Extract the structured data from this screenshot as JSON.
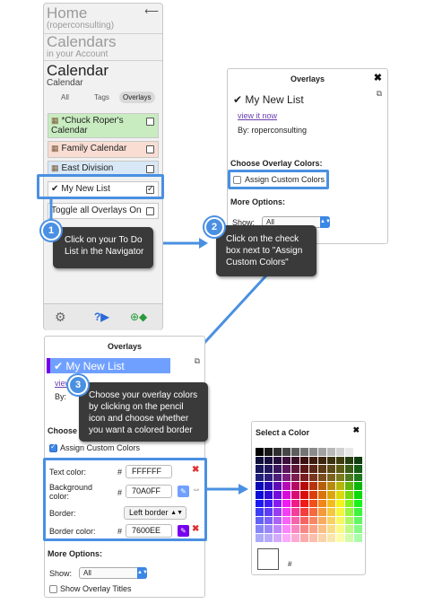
{
  "nav": {
    "home": {
      "title": "Home",
      "sub": "(roperconsulting)",
      "back_icon": "back-arrow-icon"
    },
    "calendars": {
      "title": "Calendars",
      "sub": "in your Account"
    },
    "calendar": {
      "title": "Calendar",
      "sub": "Calendar"
    },
    "tabs": [
      "All",
      "Tags",
      "Overlays"
    ],
    "items": [
      {
        "label": "*Chuck Roper's Calendar",
        "color": "#c8ecc0",
        "checked": false
      },
      {
        "label": "Family Calendar",
        "color": "#f9ddd3",
        "checked": false
      },
      {
        "label": "East Division",
        "color": "#d8e8f6",
        "checked": false
      },
      {
        "label": "My New List",
        "color": "#ffffff",
        "checked": true
      },
      {
        "label": "Toggle all Overlays On",
        "color": "#ffffff",
        "checked": false
      }
    ],
    "bottom_icons": [
      "gear-icon",
      "help-icon",
      "add-tag-icon"
    ]
  },
  "callouts": {
    "c1": {
      "num": "1",
      "text": "Click on your To Do List in the Navigator"
    },
    "c2": {
      "num": "2",
      "text": "Click on the check box next to \"Assign Custom Colors\""
    },
    "c3": {
      "num": "3",
      "text": "Choose your overlay colors by clicking on the pencil icon and choose whether you want a colored border"
    }
  },
  "panel1": {
    "title": "Overlays",
    "close": "✖",
    "list_name": "My New List",
    "view_link": "view it now",
    "by": "By: roperconsulting",
    "choose": "Choose Overlay Colors:",
    "assign": "Assign Custom Colors",
    "more": "More Options:",
    "show_label": "Show:",
    "show_value": "All"
  },
  "panel2": {
    "title": "Overlays",
    "list_name": "My New List",
    "view_frag": "view",
    "by_frag": "By:",
    "choose_frag": "Choose",
    "assign": "Assign Custom Colors",
    "text_color_label": "Text color:",
    "text_color": "FFFFFF",
    "bg_label": "Background color:",
    "bg_color": "70A0FF",
    "border_label": "Border:",
    "border_value": "Left border",
    "border_color_label": "Border color:",
    "border_color": "7600EE",
    "hash": "#",
    "more": "More Options:",
    "show_label": "Show:",
    "show_value": "All",
    "show_titles": "Show Overlay Titles",
    "accent": "#7600ee",
    "list_bg": "#70a0ff"
  },
  "picker": {
    "title": "Select a Color",
    "close": "✖",
    "hash": "#"
  }
}
